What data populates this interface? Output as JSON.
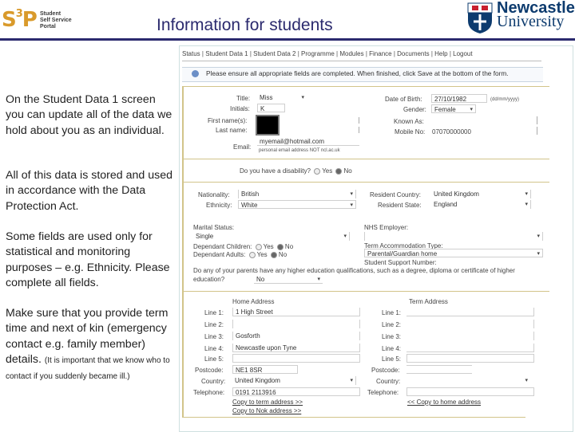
{
  "header": {
    "logo_main": "S",
    "logo_sup": "3",
    "logo_p": "P",
    "logo_sub": [
      "Student",
      "Self Service",
      "Portal"
    ],
    "title": "Information for students",
    "university_line1": "Newcastle",
    "university_line2": "University"
  },
  "left_text": {
    "p1": "On the Student Data 1 screen you can update all of the data we hold about you as an individual.",
    "p2": "All of this data is stored and used in accordance with the Data Protection Act.",
    "p3": "Some fields are used only for statistical and monitoring purposes – e.g. Ethnicity. Please complete all fields.",
    "p4_main": "Make sure that you provide term time and next of kin (emergency contact e.g. family member) details.",
    "p4_small": "(It is important that we know who to contact if you suddenly became ill.)"
  },
  "nav": {
    "items": [
      "Status",
      "Student Data 1",
      "Student Data 2",
      "Programme",
      "Modules",
      "Finance",
      "Documents",
      "Help",
      "Logout"
    ],
    "separator": " | "
  },
  "info_message": "Please ensure all appropriate fields are completed. When finished, click Save at the bottom of the form.",
  "personal": {
    "title_label": "Title:",
    "title_value": "Miss",
    "initials_label": "Initials:",
    "initials_value": "K",
    "first_name_label": "First name(s):",
    "last_name_label": "Last name:",
    "email_label": "Email:",
    "email_value": "myemail@hotmail.com",
    "email_hint": "personal email address NOT ncl.ac.uk",
    "dob_label": "Date of Birth:",
    "dob_value": "27/10/1982",
    "dob_hint": "(dd/mm/yyyy)",
    "gender_label": "Gender:",
    "gender_value": "Female",
    "known_as_label": "Known As:",
    "known_as_value": "",
    "mobile_label": "Mobile No:",
    "mobile_value": "07070000000"
  },
  "disability": {
    "question": "Do you have a disability?",
    "yes": "Yes",
    "no": "No",
    "selected": "No"
  },
  "residency": {
    "nationality_label": "Nationality:",
    "nationality_value": "British",
    "ethnicity_label": "Ethnicity:",
    "ethnicity_value": "White",
    "country_label": "Resident Country:",
    "country_value": "United Kingdom",
    "state_label": "Resident State:",
    "state_value": "England"
  },
  "status": {
    "marital_label": "Marital Status:",
    "marital_value": "Single",
    "dep_children_label": "Dependant Children:",
    "dep_children_selected": "No",
    "dep_adults_label": "Dependant Adults:",
    "dep_adults_selected": "No",
    "yes": "Yes",
    "no": "No",
    "nhs_label": "NHS Employer:",
    "nhs_value": "",
    "term_accom_label": "Term Accommodation Type:",
    "term_accom_value": "Parental/Guardian home",
    "support_label": "Student Support Number:",
    "parents_question": "Do any of your parents have any higher education qualifications, such as a degree, diploma or certificate of higher education?",
    "parents_value": "No"
  },
  "home_address": {
    "heading": "Home Address",
    "line1_label": "Line 1:",
    "line1_value": "1 High Street",
    "line2_label": "Line 2:",
    "line2_value": "",
    "line3_label": "Line 3:",
    "line3_value": "Gosforth",
    "line4_label": "Line 4:",
    "line4_value": "Newcastle upon Tyne",
    "line5_label": "Line 5:",
    "line5_value": "",
    "postcode_label": "Postcode:",
    "postcode_value": "NE1 8SR",
    "country_label": "Country:",
    "country_value": "United Kingdom",
    "telephone_label": "Telephone:",
    "telephone_value": "0191 2113916",
    "copy_term": "Copy to term address >>",
    "copy_nok": "Copy to Nok address >>"
  },
  "term_address": {
    "heading": "Term Address",
    "line1_label": "Line 1:",
    "line2_label": "Line 2:",
    "line3_label": "Line 3:",
    "line4_label": "Line 4:",
    "line5_label": "Line 5:",
    "postcode_label": "Postcode:",
    "country_label": "Country:",
    "telephone_label": "Telephone:",
    "copy_home": "<< Copy to home address"
  }
}
